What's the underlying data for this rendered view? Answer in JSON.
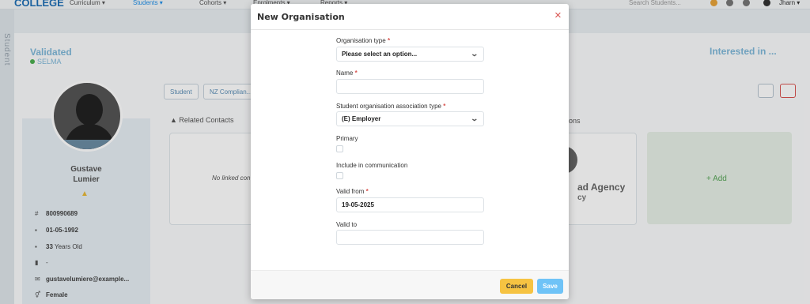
{
  "topnav": {
    "brand": "COLLEGE",
    "items": [
      "Curriculum ▾",
      "Students ▾",
      "Cohorts ▾",
      "Enrolments ▾",
      "Reports ▾"
    ],
    "search_placeholder": "Search Students...",
    "user": "Jharn ▾"
  },
  "siderail": {
    "label": "Student"
  },
  "header": {
    "status": "Validated",
    "sub": "SELMA",
    "right_status": "Interested in ..."
  },
  "profile": {
    "first_name": "Gustave",
    "last_name": "Lumier",
    "id": "800990689",
    "dob": "01-05-1992",
    "age_num": "33",
    "age_text": " Years Old",
    "phone": "-",
    "email": "gustavelumiere@example...",
    "gender": "Female"
  },
  "tabs": [
    "Student",
    "NZ Complian..."
  ],
  "related": {
    "title": "Related Contacts",
    "empty": "No linked con"
  },
  "orgs": {
    "title_tail": "ons",
    "agency": "ad Agency",
    "agency2": "cy",
    "add": "+ Add"
  },
  "modal": {
    "title": "New Organisation",
    "close_icon": "×",
    "fields": {
      "org_type": {
        "label": "Organisation type",
        "value": "Please select an option..."
      },
      "name": {
        "label": "Name",
        "value": ""
      },
      "assoc_type": {
        "label": "Student organisation association type",
        "value": "(E) Employer"
      },
      "primary": {
        "label": "Primary"
      },
      "include_comm": {
        "label": "Include in communication"
      },
      "valid_from": {
        "label": "Valid from",
        "value": "19-05-2025"
      },
      "valid_to": {
        "label": "Valid to",
        "value": ""
      }
    },
    "required_marker": "*",
    "cancel": "Cancel",
    "save": "Save"
  },
  "colors": {
    "accent": "#1f8fe8",
    "danger": "#d9534f",
    "cancel": "#f6c342",
    "save": "#6fc3f7"
  }
}
